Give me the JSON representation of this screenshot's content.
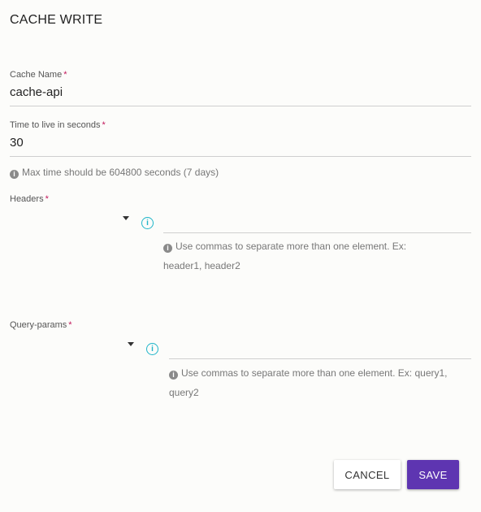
{
  "title": "CACHE WRITE",
  "cache_name": {
    "label": "Cache Name",
    "required_mark": "*",
    "value": "cache-api"
  },
  "ttl": {
    "label": "Time to live in seconds",
    "required_mark": "*",
    "value": "30",
    "hint": "Max time should be 604800 seconds (7 days)"
  },
  "headers": {
    "label": "Headers",
    "required_mark": "*",
    "value": "",
    "hint_line1": "Use commas to separate more than one element. Ex:",
    "hint_line2": "header1, header2"
  },
  "query_params": {
    "label": "Query-params",
    "required_mark": "*",
    "value": "",
    "hint_line1": "Use commas to separate more than one element. Ex: query1,",
    "hint_line2": "query2"
  },
  "icons": {
    "info": "info-icon",
    "dropdown": "caret-down-icon",
    "help": "help-icon"
  },
  "actions": {
    "cancel_label": "CANCEL",
    "save_label": "SAVE"
  },
  "colors": {
    "accent": "#5e35b1",
    "info": "#1fb5c9",
    "required": "#c2185b"
  }
}
